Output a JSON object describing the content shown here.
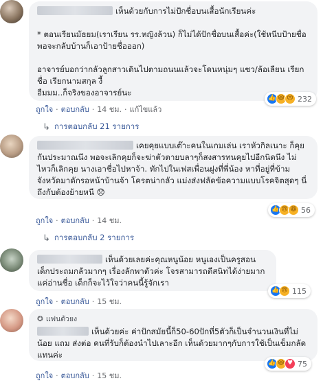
{
  "comments": [
    {
      "text": "เห็นด้วยกับการไม่ปักชื่อบนเสื้อนักเรียนค่ะ\n\n* ตอนเรียนมัธยม(เราเรียน รร.หญิงล้วน) ก็ไม่ได้ปักชื่อบนเสื้อค่ะ(ใช้หนีบป้ายชื่อ พอจะกลับบ้านก็เอาป้ายชื่อออก)\n\nอาจารย์บอกว่ากลัวลูกสาวเดินไปตามถนนแล้วจะโดนหนุ่มๆ แซว/ล้อเลียน เรียกชื่อ เรียกนามสกุล งี้\nอืมมม..ก็จริงของอาจารย์นะ",
      "reaction_count": "232",
      "reactions": [
        "like",
        "haha",
        "sad"
      ],
      "actions": {
        "like": "ถูกใจ",
        "reply": "ตอบกลับ",
        "time": "14 ชม.",
        "edited": "แก้ไขแล้ว"
      }
    },
    {
      "text": "เคยคุยแบบเต๊าะคนในเกมเล่น เราหัวกิลเนาะ ก็คุยกันประมาณนึง พอจะเลิกคุยก็จะฆ่าตัวตายบลาๆก็สงสารทนคุยไปอีกนิดนึง ไม่ไหวก็เลิกคุย นางเอาชื่อไปหาจ้า. ทักไปในเฟสเพื่อนฝูงที่พี่น้อง หาที่อยู่ที่ข้ามจังหวัดมาดักรอหน้าบ้านจ้า โครตน่ากลัว แม่งส่งฟลัดข้อความแบบโรคจิตสุดๆ นี่ถึงกับต้องย้ายหนี 😞",
      "reaction_count": "56",
      "reactions": [
        "like",
        "sad",
        "haha"
      ],
      "actions": {
        "like": "ถูกใจ",
        "reply": "ตอบกลับ",
        "time": "14 ชม."
      }
    },
    {
      "text": "เห็นด้วยเลยค่ะคุณหนูน้อย หนูเองเป็นครูสอนเด็กประถมกลัวมากๆ เรื่องลักพาตัวค่ะ โจรสามารถตีสนิทได้ง่ายมากแค่อ่านชื่อ เด็กก็จะไว้ใจว่าคนนี้รู้จักเรา",
      "reaction_count": "115",
      "reactions": [
        "like",
        "sad"
      ],
      "actions": {
        "like": "ถูกใจ",
        "reply": "ตอบกลับ",
        "time": "15 ชม."
      }
    },
    {
      "badge": "แฟนตัวยง",
      "text": "เห็นด้วยค่ะ ค่าปักสมัยนี้ก็50-60ปักที่5ตัวก็เป็นจำนวนเงินที่ไม่น้อย แถม ส่งต่อ คนที่รับก็ต้องนำไปเลาะอีก เห็นด้วยมากๆกับการใช้เป็นเข็มกลัดแทนค่ะ",
      "reaction_count": "75",
      "reactions": [
        "like",
        "haha",
        "love"
      ],
      "actions": {
        "like": "ถูกใจ",
        "reply": "ตอบกลับ",
        "time": "15 ชม."
      }
    }
  ],
  "replies": [
    {
      "label": "การตอบกลับ 21 รายการ"
    },
    {
      "label": "การตอบกลับ 2 รายการ"
    }
  ]
}
